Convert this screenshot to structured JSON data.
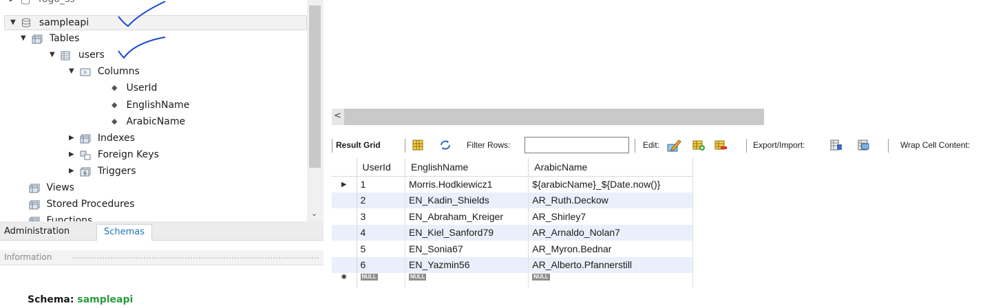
{
  "navigator": {
    "top_partial_label": "fogo_ss",
    "tree": {
      "schema": "sampleapi",
      "tables": "Tables",
      "table": "users",
      "columns_folder": "Columns",
      "columns": [
        "UserId",
        "EnglishName",
        "ArabicName"
      ],
      "indexes": "Indexes",
      "foreign_keys": "Foreign Keys",
      "triggers": "Triggers",
      "views": "Views",
      "stored_procedures": "Stored Procedures",
      "functions": "Functions"
    },
    "tabs": {
      "administration": "Administration",
      "schemas": "Schemas"
    },
    "info_label": "Information",
    "schema_label": "Schema:",
    "schema_value": "sampleapi"
  },
  "toolbar": {
    "result_grid": "Result Grid",
    "filter_rows": "Filter Rows:",
    "filter_value": "",
    "edit": "Edit:",
    "export_import": "Export/Import:",
    "wrap_cell": "Wrap Cell Content:"
  },
  "grid": {
    "columns": [
      "UserId",
      "EnglishName",
      "ArabicName"
    ],
    "rows": [
      [
        "1",
        "Morris.Hodkiewicz1",
        "${arabicName}_${Date.now()}"
      ],
      [
        "2",
        "EN_Kadin_Shields",
        "AR_Ruth.Deckow"
      ],
      [
        "3",
        "EN_Abraham_Kreiger",
        "AR_Shirley7"
      ],
      [
        "4",
        "EN_Kiel_Sanford79",
        "AR_Arnaldo_Nolan7"
      ],
      [
        "5",
        "EN_Sonia67",
        "AR_Myron.Bednar"
      ],
      [
        "6",
        "EN_Yazmin56",
        "AR_Alberto.Pfannerstill"
      ]
    ],
    "null_label": "NULL",
    "current_row_marker": "▶",
    "new_row_marker": "✱"
  },
  "colors": {
    "accent_blue": "#1e73be",
    "schema_green": "#2b9a3e",
    "alt_row": "#e9f0fb",
    "pen": "#1546d6"
  }
}
